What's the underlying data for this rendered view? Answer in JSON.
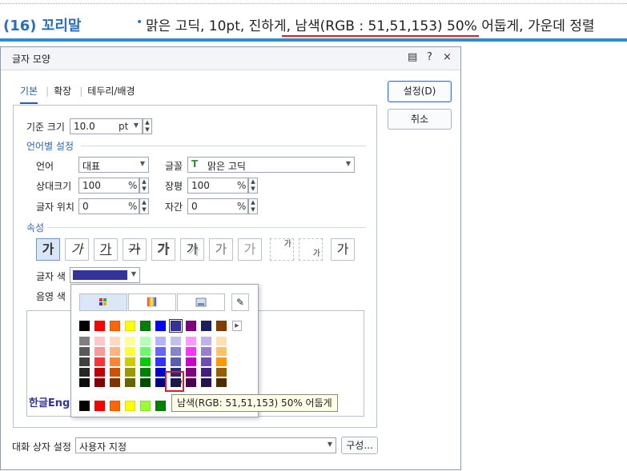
{
  "banner": {
    "title": "(16) 꼬리말",
    "bullet": "•",
    "description": "맑은 고딕, 10pt, 진하게, 남색(RGB : 51,51,153) 50% 어둡게, 가운데 정렬"
  },
  "dialog": {
    "title": "글자 모양",
    "icons": {
      "help": "?",
      "close": "×",
      "memo": "▤"
    },
    "tabs": [
      {
        "label": "기본"
      },
      {
        "label": "확장"
      },
      {
        "label": "테두리/배경"
      }
    ],
    "buttons": {
      "ok": "설정(D)",
      "cancel": "취소"
    },
    "base_size": {
      "label": "기준 크기",
      "value": "10.0",
      "unit": "pt"
    },
    "lang_section": "언어별 설정",
    "language": {
      "label": "언어",
      "value": "대표"
    },
    "font": {
      "label": "글꼴",
      "value": "맑은 고딕",
      "icon": "truetype-icon"
    },
    "rel_size": {
      "label": "상대크기",
      "value": "100",
      "unit": "%"
    },
    "width": {
      "label": "장평",
      "value": "100",
      "unit": "%"
    },
    "position": {
      "label": "글자 위치",
      "value": "0",
      "unit": "%"
    },
    "spacing": {
      "label": "자간",
      "value": "0",
      "unit": "%"
    },
    "attr_section": "속성",
    "attr_buttons": [
      "가",
      "가",
      "가",
      "가",
      "가",
      "가",
      "가",
      "가",
      "가",
      "가",
      "가"
    ],
    "text_color": {
      "label": "글자 색",
      "value": "#333399"
    },
    "shade_color": {
      "label": "음영 색"
    },
    "preview_text": "한글Eng",
    "footer": {
      "label": "대화 상자 설정",
      "value": "사용자 지정",
      "config_button": "구성..."
    }
  },
  "color_popup": {
    "top_row": [
      "#000000",
      "#ff0000",
      "#ff6600",
      "#ffff00",
      "#008000",
      "#0000ff",
      "#333399",
      "#800080",
      "#1f1f5f",
      "#7f3f00"
    ],
    "bottom_row": [
      "#000000",
      "#ff0000",
      "#ff6600",
      "#ffff00",
      "#99ff33",
      "#008000"
    ],
    "columns": [
      [
        "#7f7f7f",
        "#595959",
        "#404040",
        "#262626",
        "#0d0d0d"
      ],
      [
        "#ffc7c7",
        "#ff9999",
        "#ff3333",
        "#c00000",
        "#800000"
      ],
      [
        "#ffd9c0",
        "#ffb380",
        "#ff8533",
        "#cc5200",
        "#803300"
      ],
      [
        "#ffff99",
        "#ffff33",
        "#cccc00",
        "#999900",
        "#666600"
      ],
      [
        "#b3ffb3",
        "#66ff66",
        "#00cc00",
        "#008000",
        "#004d00"
      ],
      [
        "#b3b3ff",
        "#6666ff",
        "#3333ff",
        "#0000cc",
        "#000080"
      ],
      [
        "#c2c2e6",
        "#8585cc",
        "#5c5cb3",
        "#29297a",
        "#1a1a4d"
      ],
      [
        "#ff99ff",
        "#ff33ff",
        "#cc00cc",
        "#800080",
        "#4d004d"
      ],
      [
        "#c2b3e6",
        "#9980cc",
        "#6b4db3",
        "#3f2080",
        "#26134d"
      ],
      [
        "#ffe0b3",
        "#ffc266",
        "#ff9900",
        "#995c00",
        "#4d2e00"
      ]
    ],
    "selected_color": "#1a1a4d",
    "tooltip": "남색(RGB: 51,51,153) 50% 어둡게"
  }
}
